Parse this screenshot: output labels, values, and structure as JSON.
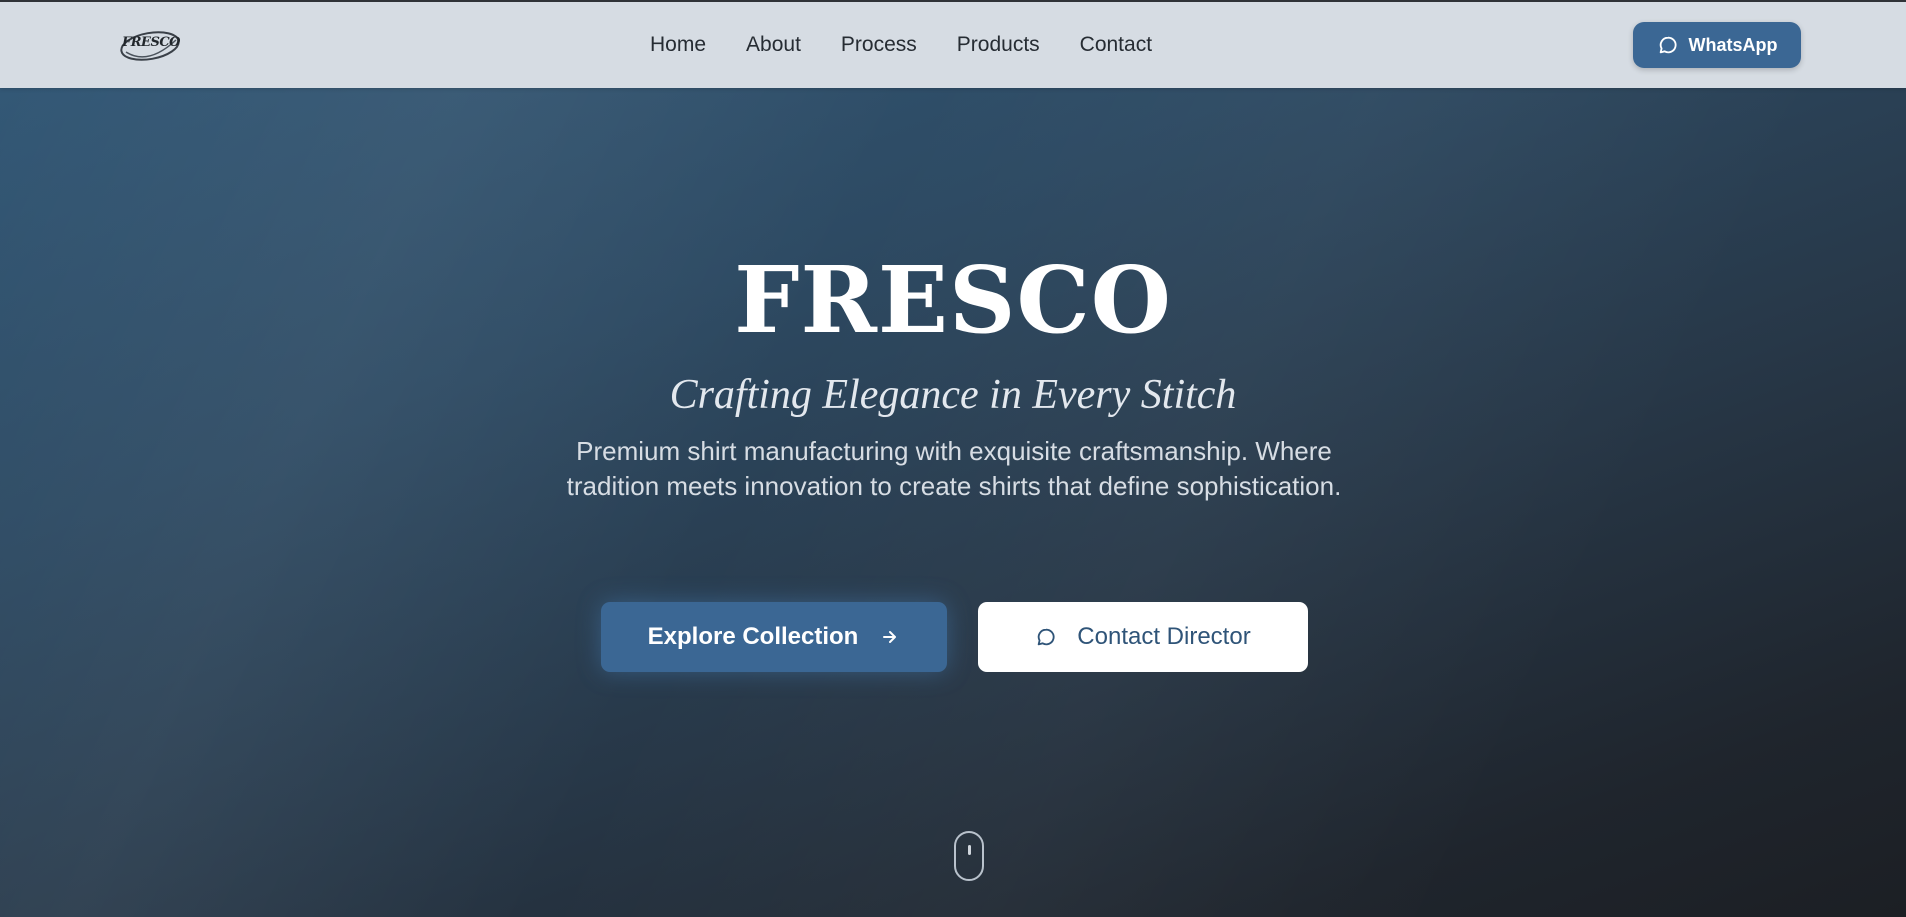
{
  "header": {
    "logo_text": "FRESCO",
    "nav": [
      "Home",
      "About",
      "Process",
      "Products",
      "Contact"
    ],
    "whatsapp_label": "WhatsApp",
    "whatsapp_icon": "chat-bubble-icon"
  },
  "hero": {
    "brand": "FRESCO",
    "tagline": "Crafting Elegance in Every Stitch",
    "description": "Premium shirt manufacturing with exquisite craftsmanship. Where tradition meets innovation to create shirts that define sophistication.",
    "explore_label": "Explore Collection",
    "explore_icon": "arrow-right-icon",
    "contact_label": "Contact Director",
    "contact_icon": "chat-bubble-icon",
    "scroll_icon": "mouse-scroll-icon"
  },
  "colors": {
    "accent": "#3b6794",
    "header_bg": "#d6dce3",
    "hero_start": "#335876",
    "hero_end": "#1c1f24"
  }
}
